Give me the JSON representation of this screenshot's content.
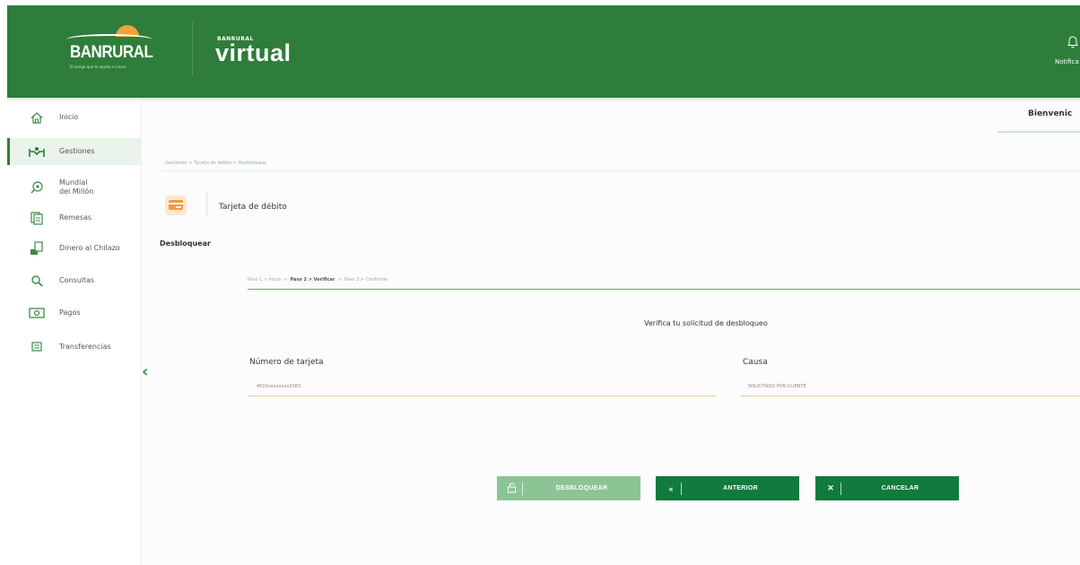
{
  "header": {
    "brand": "BANRURAL",
    "brand_tagline": "El amigo que te ayuda a crecer",
    "app_small": "BANRURAL",
    "app_name": "virtual",
    "notifications_label": "Notifica"
  },
  "sidebar": {
    "items": [
      {
        "label": "Inicio",
        "icon": "home-icon"
      },
      {
        "label": "Gestiones",
        "icon": "hands-icon",
        "active": true
      },
      {
        "label_line1": "Mundial",
        "label_line2": "del Millón",
        "icon": "ball-icon"
      },
      {
        "label": "Remesas",
        "icon": "money-icon"
      },
      {
        "label": "Dinero al Chilazo",
        "icon": "cash-icon"
      },
      {
        "label": "Consultas",
        "icon": "search-icon"
      },
      {
        "label": "Pagos",
        "icon": "bill-icon"
      },
      {
        "label": "Transferencias",
        "icon": "transfer-icon"
      }
    ]
  },
  "main": {
    "welcome": "Bienvenic",
    "breadcrumb": "Gestiones > Tarjeta de débito > Desbloquear",
    "page_title": "Tarjeta de débito",
    "section_title": "Desbloquear",
    "steps": {
      "step1": "Paso 1 > Inicio",
      "step2": "Paso 2 > Verificar",
      "step3": "Paso 3 > Confirmar"
    },
    "heading": "Verifica tu solicitud de desbloqueo",
    "fields": {
      "card_label": "Número de tarjeta",
      "card_value": "4010xxxxxxxx2083",
      "cause_label": "Causa",
      "cause_value": "SOLICITADO POR CLIENTE"
    },
    "buttons": {
      "unlock": "DESBLOQUEAR",
      "previous": "ANTERIOR",
      "cancel": "CANCELAR"
    }
  },
  "colors": {
    "header_green": "#2e7d3a",
    "button_dark": "#117a3d",
    "button_light": "#8cc496",
    "accent_orange": "#f29a3c"
  }
}
